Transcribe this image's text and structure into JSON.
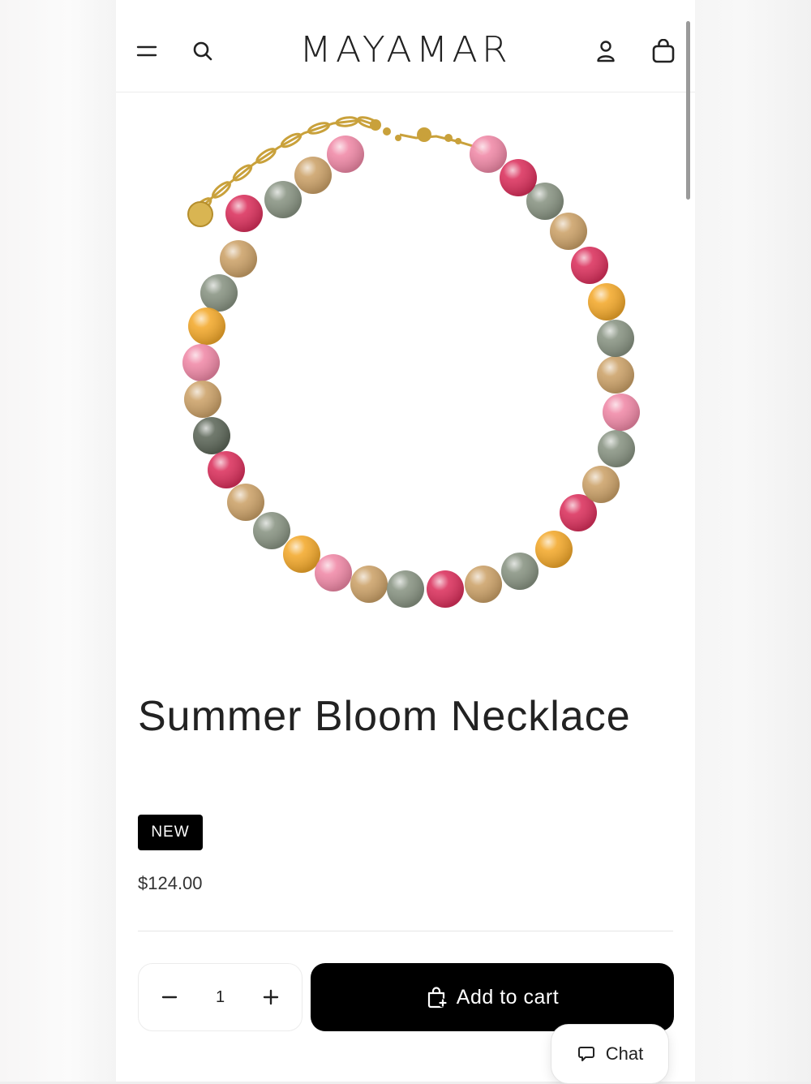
{
  "header": {
    "brand": "MAYAMAR",
    "icons": [
      "menu-icon",
      "search-icon",
      "account-icon",
      "bag-icon"
    ]
  },
  "product": {
    "title": "Summer Bloom Necklace",
    "badge": "NEW",
    "price": "$124.00",
    "image_alt": "Summer Bloom Necklace with multicolor beads and gold chain"
  },
  "purchase": {
    "quantity": "1",
    "decrease_symbol": "−",
    "increase_symbol": "+",
    "add_to_cart_label": "Add to cart"
  },
  "chat": {
    "label": "Chat"
  },
  "colors": {
    "bead_pink": "#ef7fa0",
    "bead_red": "#d81f4f",
    "bead_amber": "#f2a21a",
    "bead_tan": "#c89a5c",
    "bead_gray": "#7f8b78",
    "gold": "#c9a13b",
    "button": "#000000"
  }
}
